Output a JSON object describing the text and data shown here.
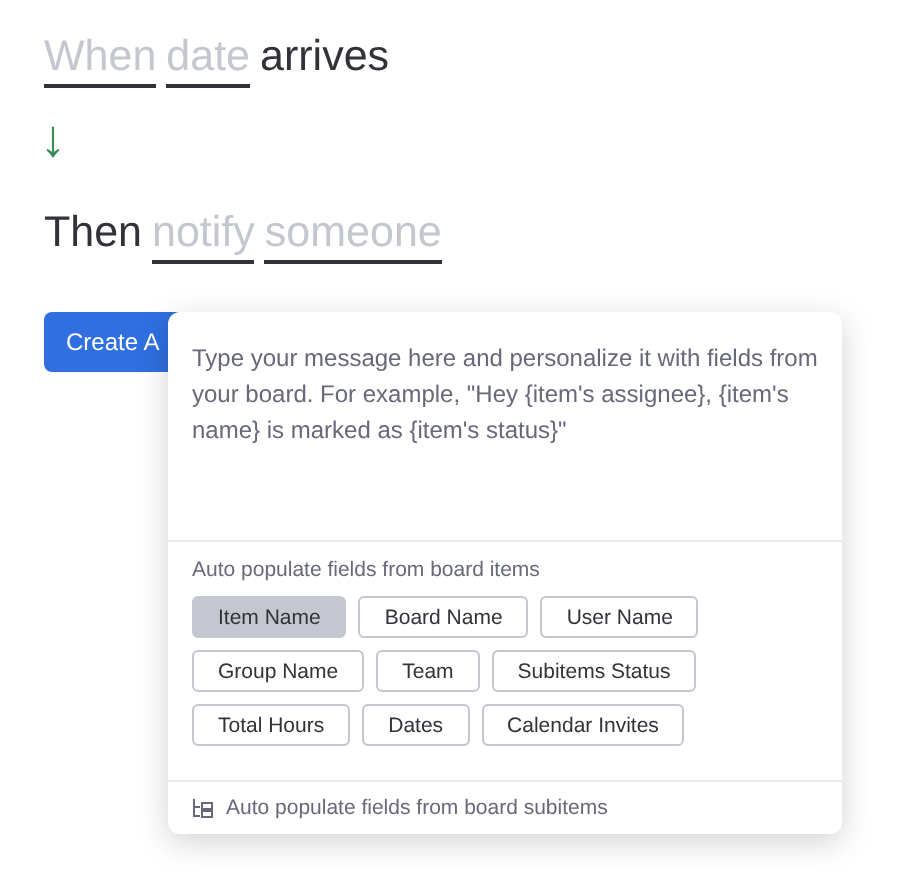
{
  "sentences": [
    {
      "parts": [
        {
          "kind": "slot",
          "text": "When"
        },
        {
          "kind": "slot",
          "text": "date"
        },
        {
          "kind": "word",
          "text": "arrives"
        }
      ]
    },
    {
      "parts": [
        {
          "kind": "word",
          "text": "Then"
        },
        {
          "kind": "slot",
          "text": "notify"
        },
        {
          "kind": "slot",
          "text": "someone"
        }
      ]
    }
  ],
  "arrow": "↓",
  "button": {
    "label": "Create A"
  },
  "popover": {
    "message": {
      "placeholder": "Type your message here and personalize it with fields from your board. For example, \"Hey {item's assignee}, {item's name} is marked as {item's status}\""
    },
    "fields_label": "Auto populate fields from board items",
    "field_rows": [
      [
        {
          "label": "Item Name",
          "selected": true
        },
        {
          "label": "Board Name",
          "selected": false
        },
        {
          "label": "User Name",
          "selected": false
        }
      ],
      [
        {
          "label": "Group Name",
          "selected": false
        },
        {
          "label": "Team",
          "selected": false
        },
        {
          "label": "Subitems Status",
          "selected": false
        }
      ],
      [
        {
          "label": "Total Hours",
          "selected": false
        },
        {
          "label": "Dates",
          "selected": false
        },
        {
          "label": "Calendar Invites",
          "selected": false
        }
      ]
    ],
    "footer": "Auto populate fields from board subitems"
  }
}
